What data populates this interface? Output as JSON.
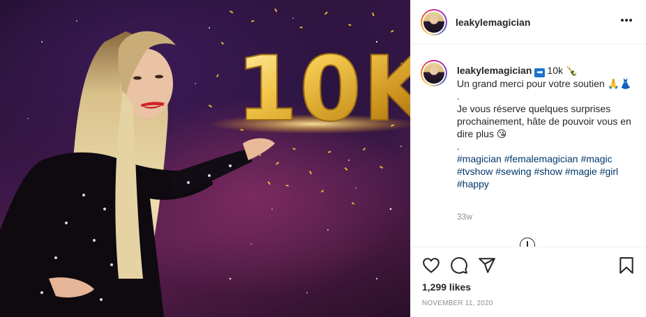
{
  "post": {
    "username": "leakylemagician",
    "image_text": "10K",
    "caption": {
      "username": "leakylemagician",
      "arrow_emoji": "➡",
      "headline": "10k 🍾",
      "line1": "Un grand merci pour votre soutien 🙏👗",
      "dot1": ".",
      "line2": "Je vous réserve quelques surprises prochainement, hâte de pouvoir vous en dire plus 😘",
      "dot2": ".",
      "hashtags": [
        "#magician",
        "#femalemagician",
        "#magic",
        "#tvshow",
        "#sewing",
        "#show",
        "#magie",
        "#girl",
        "#happy"
      ]
    },
    "time_ago": "33w",
    "likes": "1,299 likes",
    "date": "NOVEMBER 11, 2020"
  },
  "icons": {
    "more": "more-options-icon",
    "load_more": "load-more-comments-icon",
    "like": "heart-icon",
    "comment": "comment-icon",
    "share": "paper-plane-icon",
    "save": "bookmark-icon"
  },
  "colors": {
    "hashtag": "#00376b",
    "muted": "#8e8e8e",
    "text": "#262626",
    "gold": "#e8b63a"
  }
}
